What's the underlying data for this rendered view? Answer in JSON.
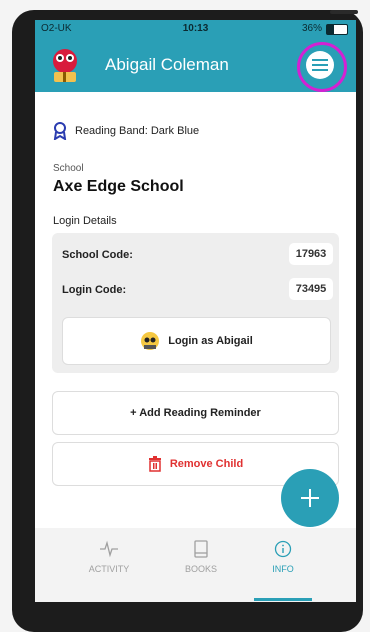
{
  "status_bar": {
    "carrier": "O2-UK",
    "time": "10:13",
    "battery": "36%"
  },
  "header": {
    "title": "Abigail Coleman"
  },
  "reading_band": {
    "label": "Reading Band: Dark Blue"
  },
  "school": {
    "label": "School",
    "name": "Axe Edge School"
  },
  "login": {
    "heading": "Login Details",
    "school_code_label": "School Code:",
    "school_code": "17963",
    "login_code_label": "Login Code:",
    "login_code": "73495",
    "login_as": "Login as Abigail"
  },
  "actions": {
    "add_reminder": "+ Add Reading Reminder",
    "remove_child": "Remove Child"
  },
  "tabs": [
    {
      "label": "ACTIVITY",
      "icon": "activity-icon"
    },
    {
      "label": "BOOKS",
      "icon": "book-icon"
    },
    {
      "label": "INFO",
      "icon": "info-icon",
      "active": true
    }
  ],
  "colors": {
    "brand": "#2a9fb6",
    "danger": "#e03131",
    "highlight": "#d321d3"
  }
}
